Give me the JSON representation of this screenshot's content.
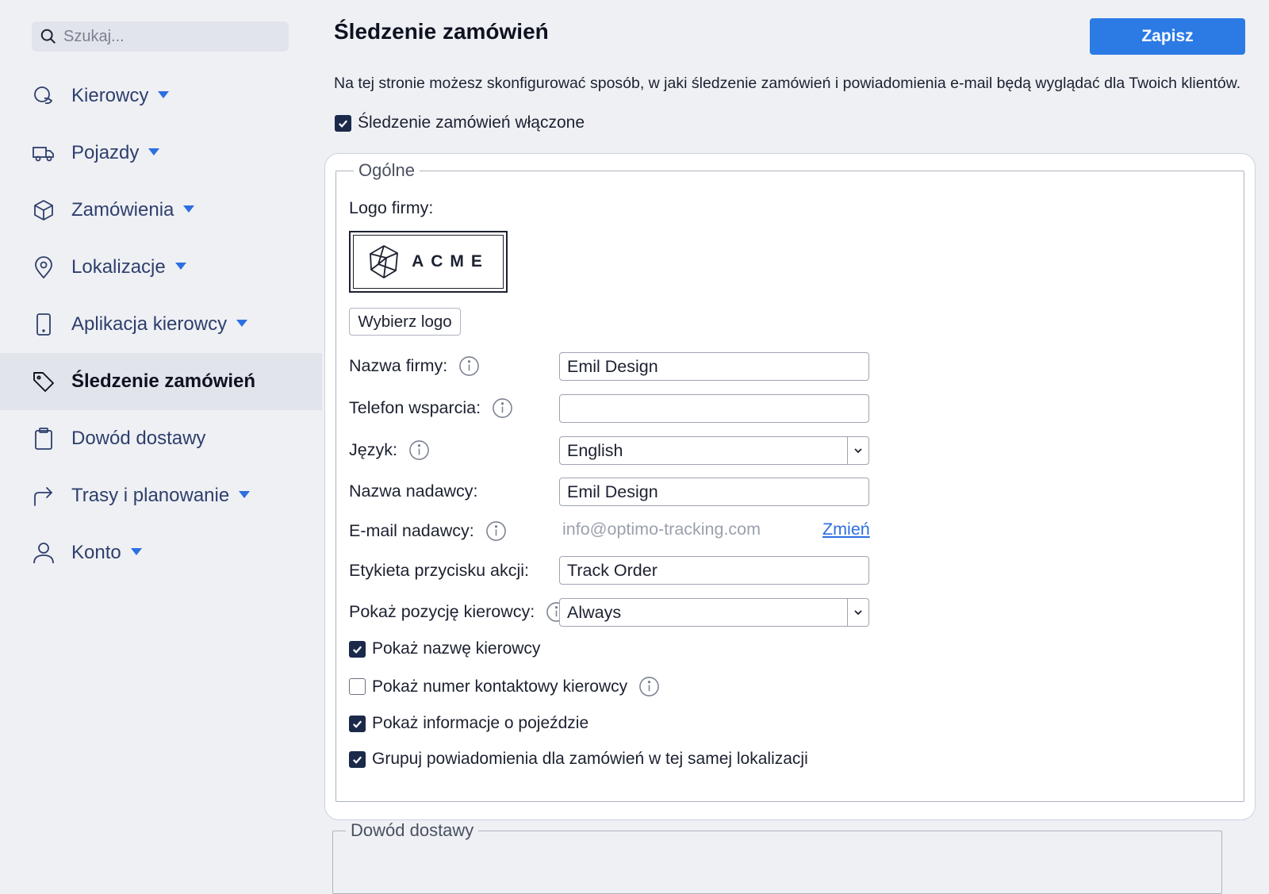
{
  "sidebar": {
    "search": {
      "placeholder": "Szukaj..."
    },
    "items": [
      {
        "label": "Kierowcy",
        "icon": "drivers-icon",
        "has_caret": true
      },
      {
        "label": "Pojazdy",
        "icon": "truck-icon",
        "has_caret": true
      },
      {
        "label": "Zamówienia",
        "icon": "box-icon",
        "has_caret": true
      },
      {
        "label": "Lokalizacje",
        "icon": "map-pin-icon",
        "has_caret": true
      },
      {
        "label": "Aplikacja kierowcy",
        "icon": "phone-icon",
        "has_caret": true
      },
      {
        "label": "Śledzenie zamówień",
        "icon": "tag-icon",
        "has_caret": false,
        "active": true
      },
      {
        "label": "Dowód dostawy",
        "icon": "clipboard-icon",
        "has_caret": false
      },
      {
        "label": "Trasy i planowanie",
        "icon": "route-arrow-icon",
        "has_caret": true
      },
      {
        "label": "Konto",
        "icon": "user-icon",
        "has_caret": true
      }
    ]
  },
  "header": {
    "title": "Śledzenie zamówień",
    "save_label": "Zapisz",
    "description": "Na tej stronie możesz skonfigurować sposób, w jaki śledzenie zamówień i powiadomienia e-mail będą wyglądać dla Twoich klientów."
  },
  "tracking_enabled": {
    "label": "Śledzenie zamówień włączone",
    "checked": true
  },
  "general": {
    "legend": "Ogólne",
    "logo_label": "Logo firmy:",
    "logo_text": "ACME",
    "choose_logo_label": "Wybierz logo",
    "company_name": {
      "label": "Nazwa firmy:",
      "value": "Emil Design"
    },
    "support_phone": {
      "label": "Telefon wsparcia:",
      "value": ""
    },
    "language": {
      "label": "Język:",
      "value": "English"
    },
    "sender_name": {
      "label": "Nazwa nadawcy:",
      "value": "Emil Design"
    },
    "sender_email": {
      "label": "E-mail nadawcy:",
      "value": "info@optimo-tracking.com",
      "change_label": "Zmień"
    },
    "action_button_label": {
      "label": "Etykieta przycisku akcji:",
      "value": "Track Order"
    },
    "show_driver_position": {
      "label": "Pokaż pozycję kierowcy:",
      "value": "Always"
    },
    "options": [
      {
        "label": "Pokaż nazwę kierowcy",
        "checked": true
      },
      {
        "label": "Pokaż numer kontaktowy kierowcy",
        "checked": false
      },
      {
        "label": "Pokaż informacje o pojeździe",
        "checked": true
      },
      {
        "label": "Grupuj powiadomienia dla zamówień w tej samej lokalizacji",
        "checked": true
      }
    ]
  },
  "proof_of_delivery": {
    "legend": "Dowód dostawy"
  },
  "colors": {
    "accent": "#2c7be5",
    "link": "#2c6fe0",
    "checkbox": "#1b2a4a"
  }
}
